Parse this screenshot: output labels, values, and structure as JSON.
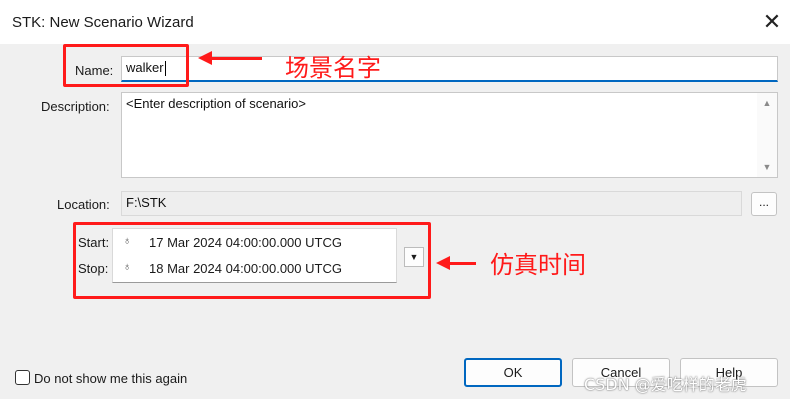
{
  "window": {
    "title": "STK: New Scenario Wizard",
    "close_glyph": "✕"
  },
  "form": {
    "name_label": "Name:",
    "name_value": "walker",
    "description_label": "Description:",
    "description_value": "<Enter description of scenario>",
    "location_label": "Location:",
    "location_value": "F:\\STK",
    "browse_label": "...",
    "start_label": "Start:",
    "start_value": "17 Mar 2024 04:00:00.000 UTCG",
    "stop_label": "Stop:",
    "stop_value": "18 Mar 2024 04:00:00.000 UTCG",
    "time_icon": "☃"
  },
  "buttons": {
    "ok": "OK",
    "cancel": "Cancel",
    "help": "Help"
  },
  "checkbox": {
    "label": "Do not show me this again",
    "checked": false
  },
  "annotations": {
    "name_note": "场景名字",
    "time_note": "仿真时间",
    "accent_color": "#ff1a1a"
  },
  "watermark": "CSDN @爱吃样的老虎",
  "icons": {
    "close": "close-icon",
    "time": "time-icon",
    "dropdown": "chevron-down-icon",
    "scroll_up": "scroll-up-arrow-icon",
    "scroll_down": "scroll-down-arrow-icon"
  }
}
